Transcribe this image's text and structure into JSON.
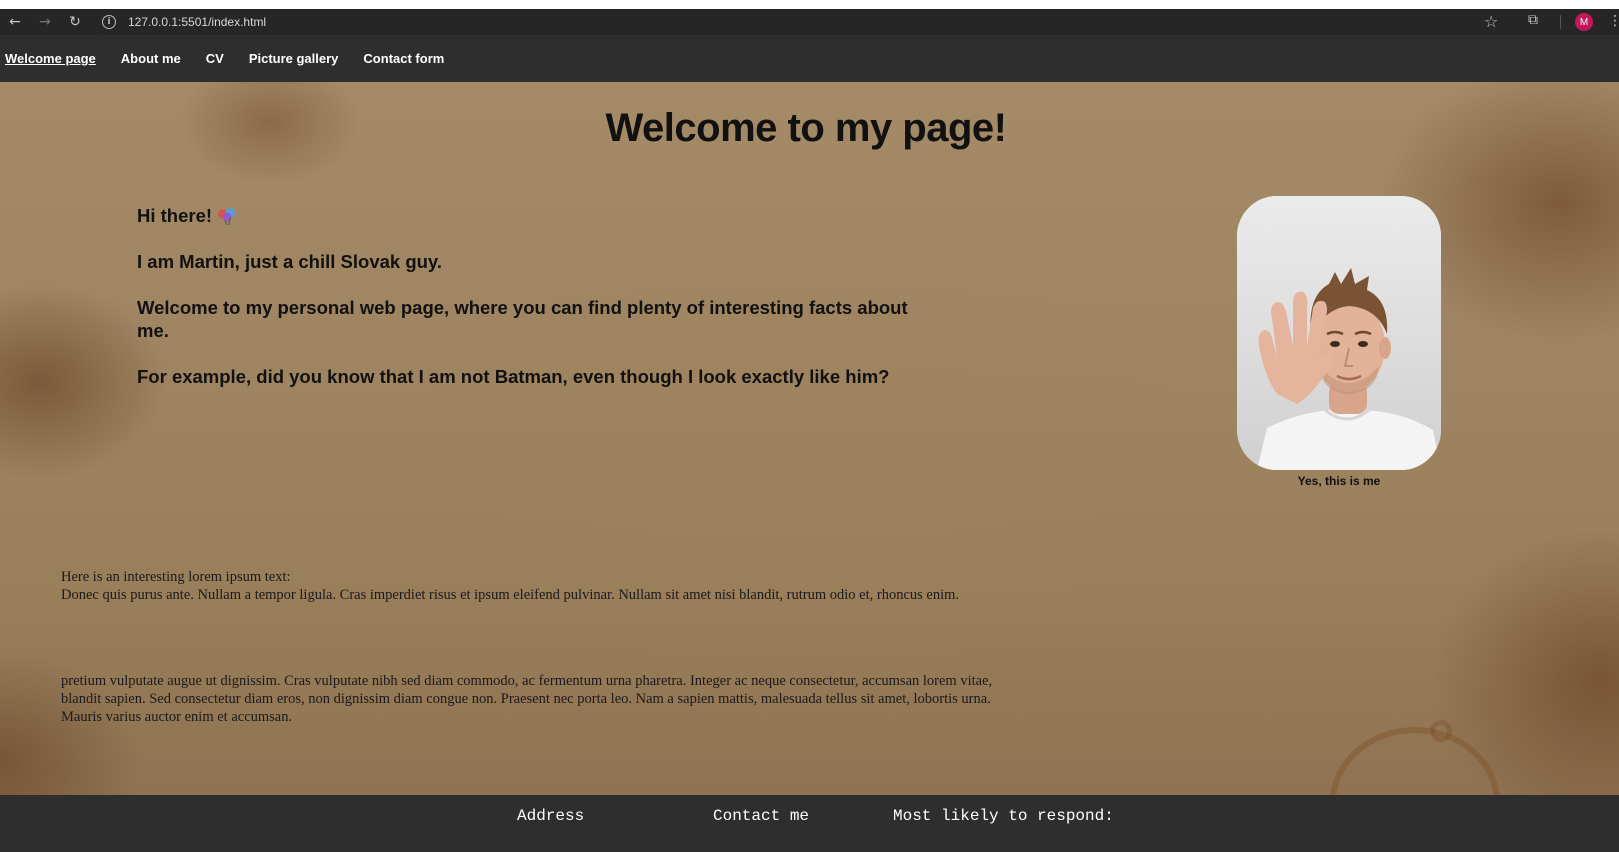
{
  "browser": {
    "url": "127.0.0.1:5501/index.html",
    "avatar_letter": "M"
  },
  "nav": {
    "items": [
      {
        "label": "Welcome page",
        "active": true
      },
      {
        "label": "About me"
      },
      {
        "label": "CV"
      },
      {
        "label": "Picture gallery"
      },
      {
        "label": "Contact form"
      }
    ]
  },
  "main": {
    "title": "Welcome to my page!",
    "greeting": "Hi there!",
    "intro_name": "I am Martin, just a chill Slovak guy.",
    "intro_welcome": "Welcome to my personal web page, where you can find plenty of interesting facts about me.",
    "intro_fact": "For example, did you know that I am not Batman, even though I look exactly like him?",
    "photo_caption": "Yes, this is me",
    "lorem_heading": "Here is an interesting lorem ipsum text:",
    "lorem_line": "Donec quis purus ante. Nullam a tempor ligula. Cras imperdiet risus et ipsum eleifend pulvinar. Nullam sit amet nisi blandit, rutrum odio et, rhoncus enim.",
    "lorem_paragraph": "pretium vulputate augue ut dignissim. Cras vulputate nibh sed diam commodo, ac fermentum urna pharetra. Integer ac neque consectetur, accumsan lorem vitae, blandit sapien. Sed consectetur diam eros, non dignissim diam congue non. Praesent nec porta leo. Nam a sapien mattis, malesuada tellus sit amet, lobortis urna. Mauris varius auctor enim et accumsan."
  },
  "footer": {
    "address": "Address",
    "contact": "Contact me",
    "respond": "Most likely to respond:"
  },
  "colors": {
    "nav_bg": "#2e2e2e",
    "chrome_bg": "#262626",
    "avatar": "#c2185b"
  }
}
